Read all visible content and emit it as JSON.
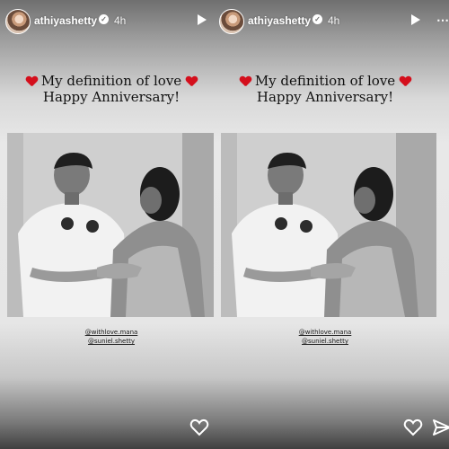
{
  "stories": [
    {
      "username": "athiyashetty",
      "time": "4h",
      "caption_line1": "My definition of love",
      "caption_line2": "Happy Anniversary!",
      "mentions": [
        "@withlove.mana",
        "@suniel.shetty"
      ],
      "icons": {
        "avatar": "avatar",
        "verified": "verified-badge-icon",
        "play": "play-icon",
        "like": "heart-outline-icon"
      }
    },
    {
      "username": "athiyashetty",
      "time": "4h",
      "caption_line1": "My definition of love",
      "caption_line2": "Happy Anniversary!",
      "mentions": [
        "@withlove.mana",
        "@suniel.shetty"
      ],
      "icons": {
        "avatar": "avatar",
        "verified": "verified-badge-icon",
        "play": "play-icon",
        "more": "more-icon",
        "like": "heart-outline-icon",
        "send": "send-icon"
      }
    }
  ],
  "colors": {
    "heart_emoji": "#d40f1c",
    "text_dark": "#111111",
    "overlay_text": "#ffffff"
  }
}
